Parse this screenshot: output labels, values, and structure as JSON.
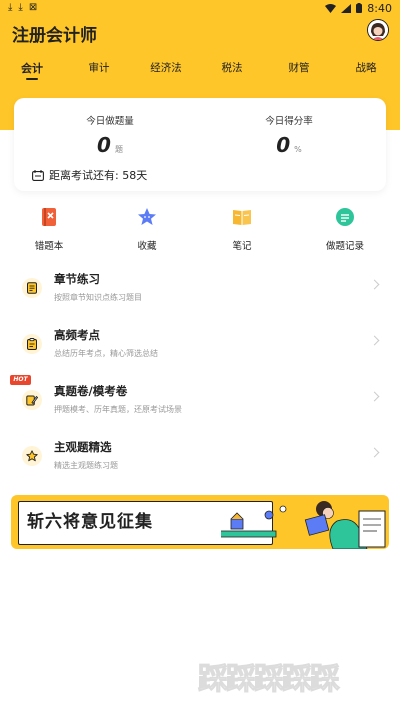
{
  "status_bar": {
    "time": "8:40",
    "left_icons": [
      "download-icon",
      "download-icon",
      "close-box-icon"
    ],
    "right_icons": [
      "wifi-icon",
      "signal-icon",
      "battery-icon"
    ]
  },
  "header": {
    "title": "注册会计师"
  },
  "tabs": [
    {
      "label": "会计",
      "active": true
    },
    {
      "label": "审计",
      "active": false
    },
    {
      "label": "经济法",
      "active": false
    },
    {
      "label": "税法",
      "active": false
    },
    {
      "label": "财管",
      "active": false
    },
    {
      "label": "战略",
      "active": false
    }
  ],
  "stats": {
    "today_count_label": "今日做题量",
    "today_count_value": "0",
    "today_count_unit": "题",
    "today_score_label": "今日得分率",
    "today_score_value": "0",
    "today_score_unit": "%",
    "exam_countdown": "距离考试还有: 58天"
  },
  "quick_actions": [
    {
      "label": "错题本",
      "icon": "wrong-book-icon",
      "color": "#F0613A"
    },
    {
      "label": "收藏",
      "icon": "star-icon",
      "color": "#5B7CF5"
    },
    {
      "label": "笔记",
      "icon": "notebook-icon",
      "color": "#F7B731"
    },
    {
      "label": "做题记录",
      "icon": "record-icon",
      "color": "#2EC59A"
    }
  ],
  "practice_list": [
    {
      "title": "章节练习",
      "subtitle": "按照章节知识点练习题目",
      "icon": "chapter-icon"
    },
    {
      "title": "高频考点",
      "subtitle": "总结历年考点，精心筛选总结",
      "icon": "clipboard-icon"
    },
    {
      "title": "真题卷/模考卷",
      "subtitle": "押题模考、历年真题，还原考试场景",
      "icon": "pen-paper-icon",
      "badge": "HOT"
    },
    {
      "title": "主观题精选",
      "subtitle": "精选主观题练习题",
      "icon": "star-outline-icon"
    }
  ],
  "banner": {
    "text": "斩六将意见征集"
  },
  "watermark": {
    "text": "踩踩踩踩踩"
  },
  "colors": {
    "brand_yellow": "#FFC629",
    "hot_red": "#E8472E"
  }
}
